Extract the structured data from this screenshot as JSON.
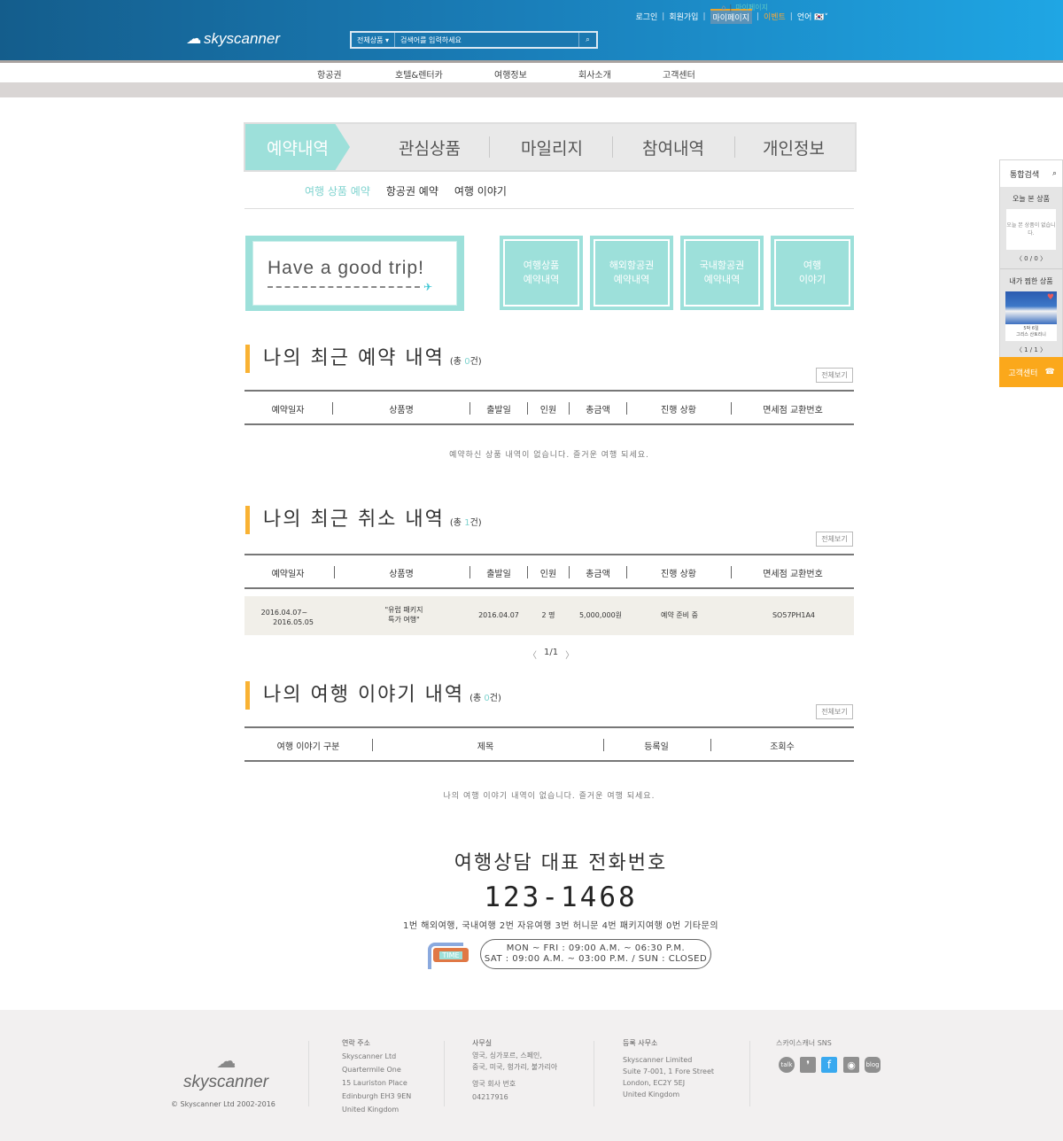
{
  "header": {
    "logo": "skyscanner",
    "top_links": [
      "로그인",
      "회원가입",
      "마이페이지",
      "이벤트",
      "언어"
    ],
    "search": {
      "category": "전체상품",
      "placeholder": "검색어를 입력하세요"
    }
  },
  "nav": [
    "항공권",
    "호텔&렌터카",
    "여행정보",
    "회사소개",
    "고객센터"
  ],
  "breadcrumb": {
    "current": "마이페이지"
  },
  "tabs": [
    "예약내역",
    "관심상품",
    "마일리지",
    "참여내역",
    "개인정보"
  ],
  "subtabs": [
    "여행 상품 예약",
    "항공권 예약",
    "여행 이야기"
  ],
  "banner": {
    "text": "Have a good trip!"
  },
  "quick_links": [
    {
      "line1": "여행상품",
      "line2": "예약내역"
    },
    {
      "line1": "해외항공권",
      "line2": "예약내역"
    },
    {
      "line1": "국내항공권",
      "line2": "예약내역"
    },
    {
      "line1": "여행",
      "line2": "이야기"
    }
  ],
  "view_all": "전체보기",
  "reservations": {
    "title": "나의 최근 예약 내역",
    "count_prefix": "(총 ",
    "count": "0",
    "count_suffix": "건)",
    "columns": [
      "예약일자",
      "상품명",
      "출발일",
      "인원",
      "총금액",
      "진행 상황",
      "면세점 교환번호"
    ],
    "empty": "예약하신 상품 내역이 없습니다. 즐거운 여행 되세요."
  },
  "cancellations": {
    "title": "나의 최근 취소 내역",
    "count_prefix": "(총 ",
    "count": "1",
    "count_suffix": "건)",
    "columns": [
      "예약일자",
      "상품명",
      "출발일",
      "인원",
      "총금액",
      "진행 상황",
      "면세점 교환번호"
    ],
    "rows": [
      {
        "date1": "2016.04.07~",
        "date2": "2016.05.05",
        "product1": "\"유럽 패키지",
        "product2": "특가 여행\"",
        "departure": "2016.04.07",
        "people": "2 명",
        "amount": "5,000,000원",
        "status": "예약 준비 중",
        "code": "SO57PH1A4"
      }
    ],
    "pagination": {
      "prev": "〈",
      "page": "1/1",
      "next": "〉"
    }
  },
  "stories": {
    "title": "나의 여행 이야기 내역",
    "count_prefix": "(총 ",
    "count": "0",
    "count_suffix": "건)",
    "columns": [
      "여행 이야기 구분",
      "제목",
      "등록일",
      "조회수"
    ],
    "empty": "나의 여행 이야기 내역이 없습니다. 즐거운 여행 되세요."
  },
  "contact": {
    "title": "여행상담 대표 전화번호",
    "phone": "123-1468",
    "menu": "1번 해외여행, 국내여행  2번 자유여행  3번 허니문  4번  패키지여행  0번  기타문의",
    "time_label": "TIME",
    "hours1": "MON ~ FRI : 09:00 A.M. ~ 06:30 P.M.",
    "hours2": "SAT : 09:00 A.M. ~ 03:00 P.M. / SUN : CLOSED"
  },
  "footer": {
    "logo": "skyscanner",
    "copyright": "© Skyscanner Ltd 2002-2016",
    "contact": {
      "heading": "연락 주소",
      "lines": [
        "Skyscanner Ltd",
        "Quartermile One",
        "15 Lauriston Place",
        "Edinburgh EH3 9EN",
        "United Kingdom"
      ]
    },
    "office": {
      "heading": "사무실",
      "lines": [
        "영국, 싱가포르, 스페인,",
        "중국, 미국, 헝가리, 불가리아"
      ],
      "reg_heading": "영국 회사 번호",
      "reg_number": "04217916"
    },
    "registered": {
      "heading": "등록 사무소",
      "lines": [
        "Skyscanner Limited",
        "Suite 7-001, 1 Fore Street",
        "London, EC2Y 5EJ",
        "United Kingdom"
      ]
    },
    "sns": {
      "heading": "스카이스캐너 SNS",
      "items": [
        "talk",
        "story",
        "f",
        "instagram",
        "blog"
      ]
    }
  },
  "sidebar": {
    "search": "통합검색",
    "recent_title": "오늘 본 상품",
    "recent_empty": "오늘 본 상품이 없습니다.",
    "recent_pager": "〈 0 / 0 〉",
    "wish_title": "내가 찜한 상품",
    "wish_caption1": "5박 6일",
    "wish_caption2": "그리스 산토리니",
    "wish_pager": "〈 1 / 1 〉",
    "cs": "고객센터"
  },
  "colors": {
    "accent": "#9de0da",
    "orange": "#f9b233",
    "header": "#1a7fba"
  }
}
